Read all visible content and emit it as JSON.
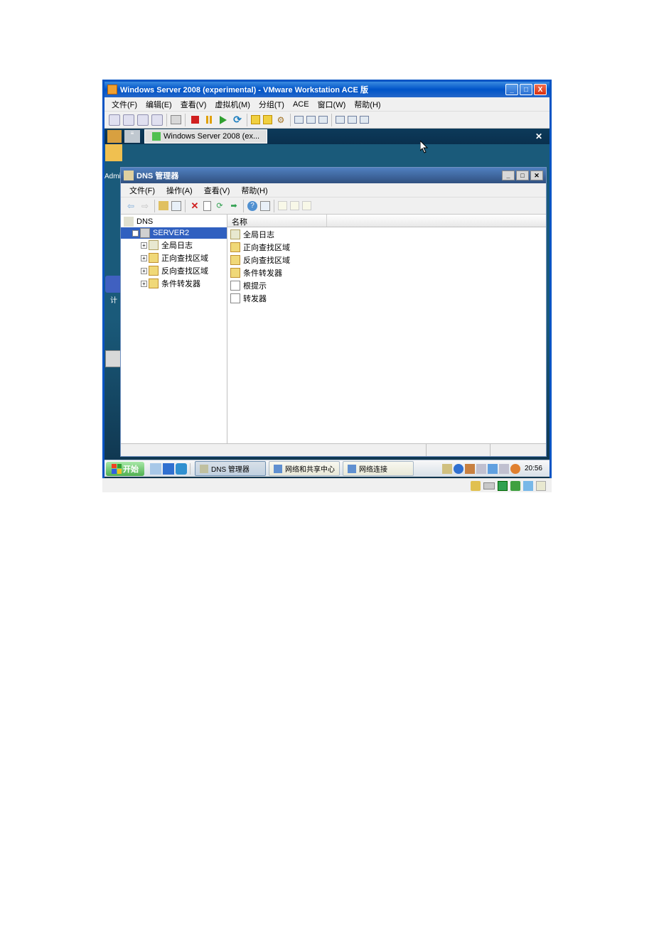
{
  "outerWindow": {
    "title": "Windows Server 2008 (experimental) - VMware Workstation ACE 版",
    "menu": [
      "文件(F)",
      "编辑(E)",
      "查看(V)",
      "虚拟机(M)",
      "分组(T)",
      "ACE",
      "窗口(W)",
      "帮助(H)"
    ],
    "tabLabel": "Windows Server 2008 (ex..."
  },
  "dnsWindow": {
    "title": "DNS 管理器",
    "menu": [
      "文件(F)",
      "操作(A)",
      "查看(V)",
      "帮助(H)"
    ],
    "tree": {
      "root": "DNS",
      "server": "SERVER2",
      "nodes": [
        "全局日志",
        "正向查找区域",
        "反向查找区域",
        "条件转发器"
      ]
    },
    "listHeader": "名称",
    "listItems": [
      "全局日志",
      "正向查找区域",
      "反向查找区域",
      "条件转发器",
      "根提示",
      "转发器"
    ]
  },
  "taskbar": {
    "start": "开始",
    "tasks": [
      "DNS 管理器",
      "网络和共享中心",
      "网络连接"
    ],
    "time": "20:56"
  },
  "desktopLabels": [
    "Admin",
    "计"
  ]
}
